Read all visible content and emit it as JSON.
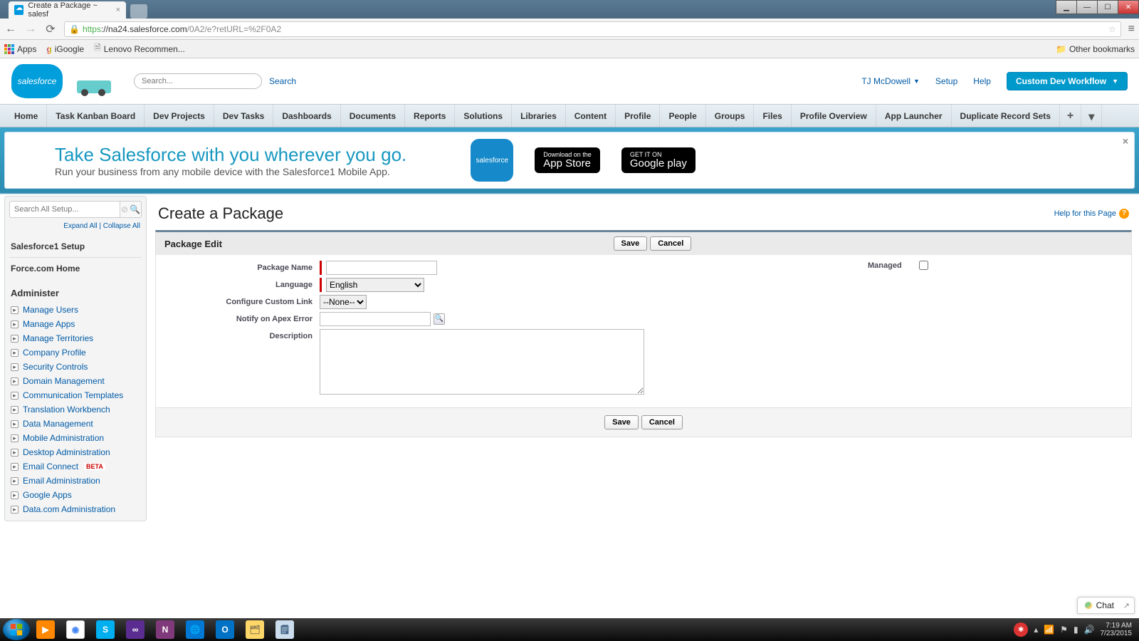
{
  "browser": {
    "tab_title": "Create a Package ~ salesf",
    "url_proto": "https",
    "url_host": "://na24.salesforce.com",
    "url_path": "/0A2/e?retURL=%2F0A2",
    "bookmarks": {
      "apps": "Apps",
      "igoogle": "iGoogle",
      "lenovo": "Lenovo Recommen...",
      "other": "Other bookmarks"
    }
  },
  "header": {
    "logo_text": "salesforce",
    "search_placeholder": "Search...",
    "search_btn": "Search",
    "user_name": "TJ McDowell",
    "setup": "Setup",
    "help": "Help",
    "app_menu": "Custom Dev Workflow"
  },
  "tabs": [
    "Home",
    "Task Kanban Board",
    "Dev Projects",
    "Dev Tasks",
    "Dashboards",
    "Documents",
    "Reports",
    "Solutions",
    "Libraries",
    "Content",
    "Profile",
    "People",
    "Groups",
    "Files",
    "Profile Overview",
    "App Launcher",
    "Duplicate Record Sets"
  ],
  "promo": {
    "title": "Take Salesforce with you wherever you go.",
    "subtitle": "Run your business from any mobile device with the Salesforce1 Mobile App.",
    "appstore_small": "Download on the",
    "appstore_big": "App Store",
    "play_small": "GET IT ON",
    "play_big": "Google play",
    "app_label": "salesforce"
  },
  "sidebar": {
    "search_placeholder": "Search All Setup...",
    "expand": "Expand All",
    "collapse": "Collapse All",
    "setup1": "Salesforce1 Setup",
    "fcom": "Force.com Home",
    "administer": "Administer",
    "items": [
      "Manage Users",
      "Manage Apps",
      "Manage Territories",
      "Company Profile",
      "Security Controls",
      "Domain Management",
      "Communication Templates",
      "Translation Workbench",
      "Data Management",
      "Mobile Administration",
      "Desktop Administration",
      "Email Connect",
      "Email Administration",
      "Google Apps",
      "Data.com Administration"
    ],
    "beta": "BETA"
  },
  "page": {
    "title": "Create a Package",
    "help": "Help for this Page",
    "section": "Package Edit",
    "save": "Save",
    "cancel": "Cancel",
    "labels": {
      "name": "Package Name",
      "language": "Language",
      "ccl": "Configure Custom Link",
      "notify": "Notify on Apex Error",
      "desc": "Description",
      "managed": "Managed"
    },
    "language_value": "English",
    "ccl_value": "--None--"
  },
  "chat": {
    "label": "Chat"
  },
  "taskbar": {
    "time": "7:19 AM",
    "date": "7/23/2015"
  }
}
